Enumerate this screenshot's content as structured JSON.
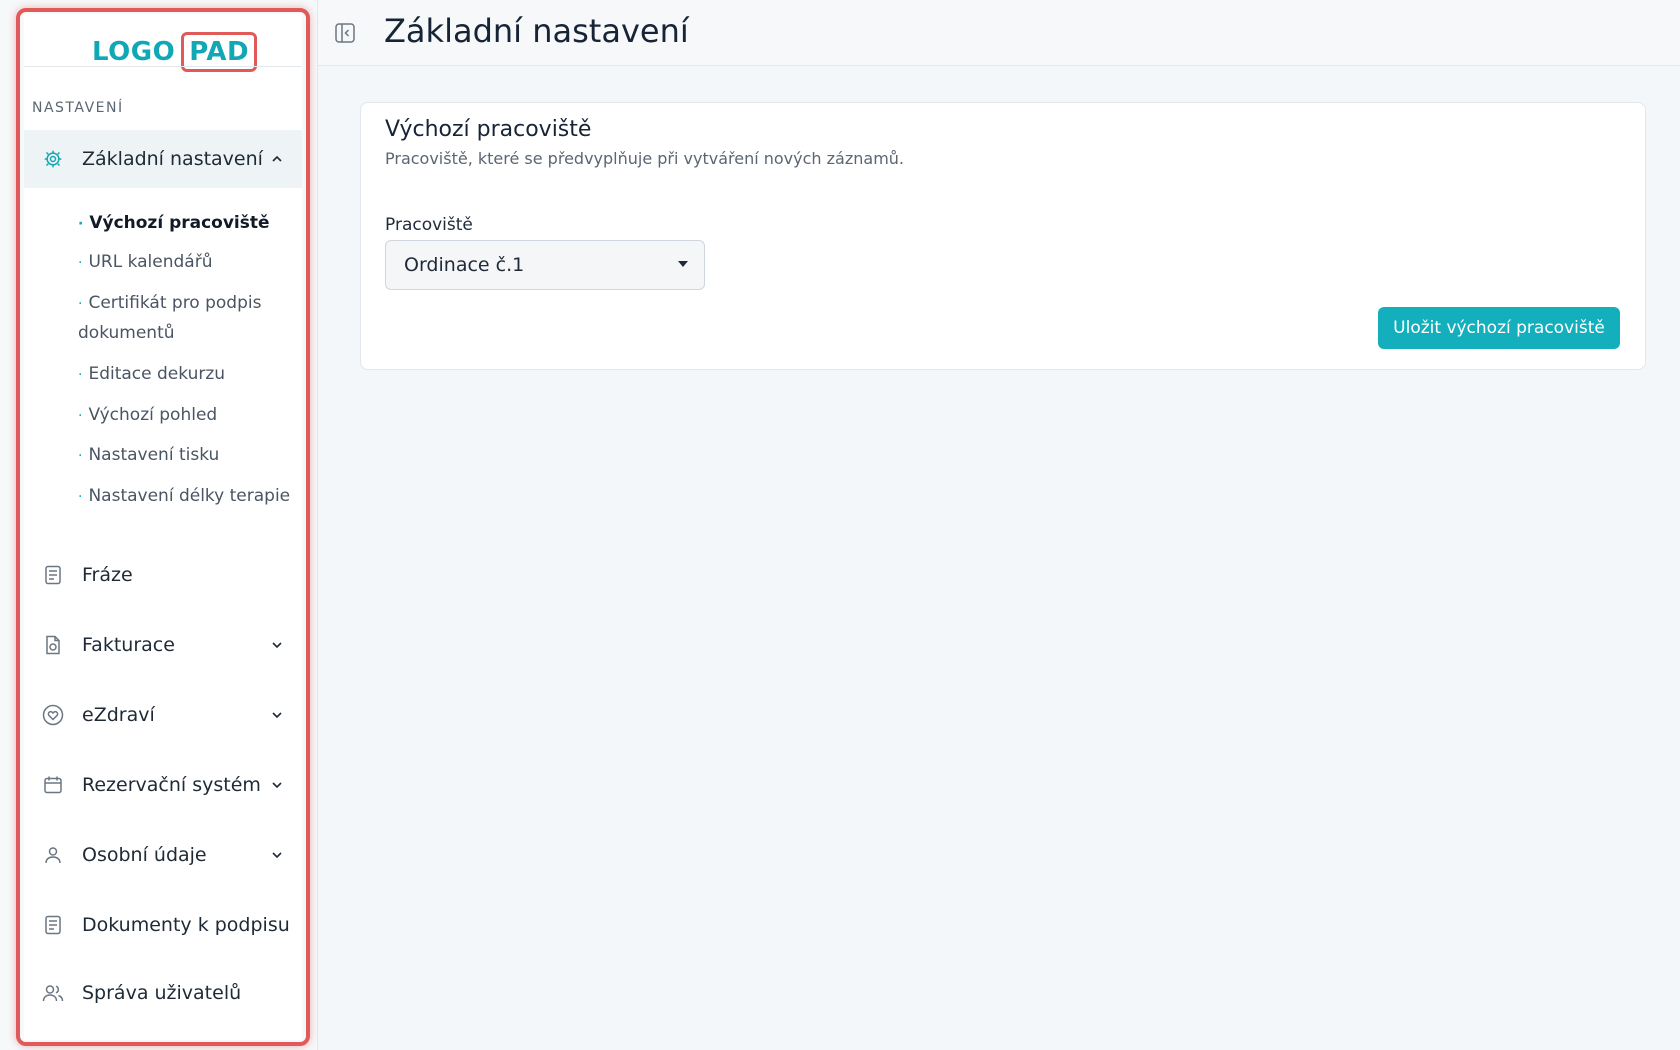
{
  "logo": {
    "part1": "LOGO",
    "part2": "PAD"
  },
  "header": {
    "title": "Základní nastavení"
  },
  "sidebar": {
    "section_label": "NASTAVENÍ",
    "groups": [
      {
        "label": "Základní nastavení",
        "icon": "gear-icon",
        "expanded": true
      },
      {
        "label": "Fráze",
        "icon": "document-icon"
      },
      {
        "label": "Fakturace",
        "icon": "invoice-icon"
      },
      {
        "label": "eZdraví",
        "icon": "heart-icon"
      },
      {
        "label": "Rezervační systém",
        "icon": "calendar-icon"
      },
      {
        "label": "Osobní údaje",
        "icon": "user-icon"
      },
      {
        "label": "Dokumenty k podpisu",
        "icon": "document-icon"
      },
      {
        "label": "Správa uživatelů",
        "icon": "users-icon"
      }
    ],
    "subitems": [
      {
        "label": "Výchozí pracoviště",
        "current": true
      },
      {
        "label": "URL kalendářů"
      },
      {
        "label": "Certifikát pro podpis"
      },
      {
        "label": "dokumentů"
      },
      {
        "label": "Editace dekurzu"
      },
      {
        "label": "Výchozí pohled"
      },
      {
        "label": "Nastavení tisku"
      },
      {
        "label": "Nastavení délky terapie"
      }
    ],
    "bullet": "·"
  },
  "card": {
    "title": "Výchozí pracoviště",
    "subtitle": "Pracoviště, které se předvyplňuje při vytváření nových záznamů.",
    "field_label": "Pracoviště",
    "select_value": "Ordinace č.1",
    "save_label": "Uložit výchozí pracoviště"
  },
  "colors": {
    "accent": "#13afbd",
    "highlight": "#e05a5a",
    "text": "#1f2a37"
  }
}
